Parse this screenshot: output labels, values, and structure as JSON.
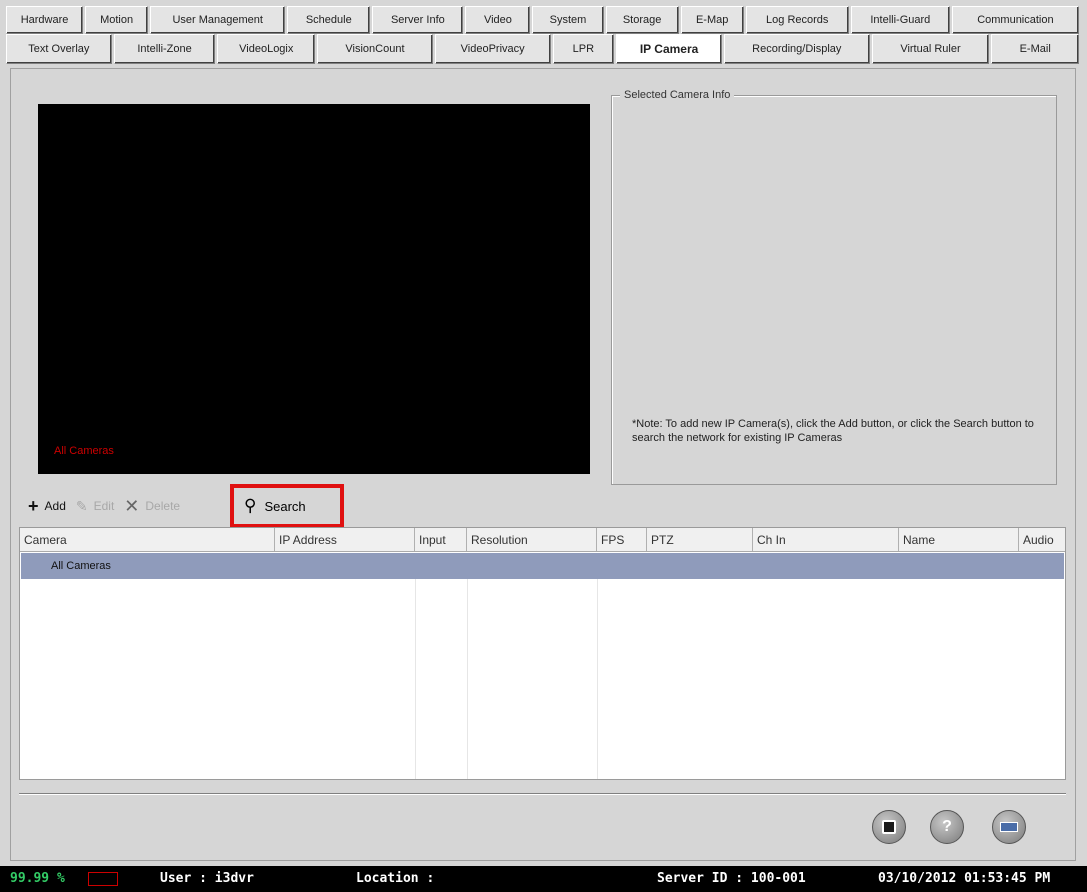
{
  "tabs_row1": [
    "Hardware",
    "Motion",
    "User Management",
    "Schedule",
    "Server Info",
    "Video",
    "System",
    "Storage",
    "E-Map",
    "Log Records",
    "Intelli-Guard",
    "Communication"
  ],
  "tabs_row2": [
    "Text Overlay",
    "Intelli-Zone",
    "VideoLogix",
    "VisionCount",
    "VideoPrivacy",
    "LPR",
    "IP Camera",
    "Recording/Display",
    "Virtual Ruler",
    "E-Mail"
  ],
  "active_tab": "IP Camera",
  "video": {
    "overlay_label": "All Cameras"
  },
  "camera_info": {
    "legend": "Selected Camera Info",
    "note": "*Note: To add new IP Camera(s), click the Add button, or click the Search button to search the network for existing IP Cameras"
  },
  "toolbar": {
    "add": "Add",
    "edit": "Edit",
    "delete": "Delete",
    "search": "Search"
  },
  "grid": {
    "columns": [
      "Camera",
      "IP Address",
      "Input",
      "Resolution",
      "FPS",
      "PTZ",
      "Ch In",
      "Name",
      "Audio"
    ],
    "rows": [
      {
        "camera": "All Cameras"
      }
    ]
  },
  "footer_buttons": [
    "save-icon",
    "help-icon",
    "keyboard-icon"
  ],
  "status": {
    "percent": "99.99 %",
    "user": "User : i3dvr",
    "location": "Location :",
    "server_id": "Server ID : 100-001",
    "datetime": "03/10/2012  01:53:45 PM"
  }
}
